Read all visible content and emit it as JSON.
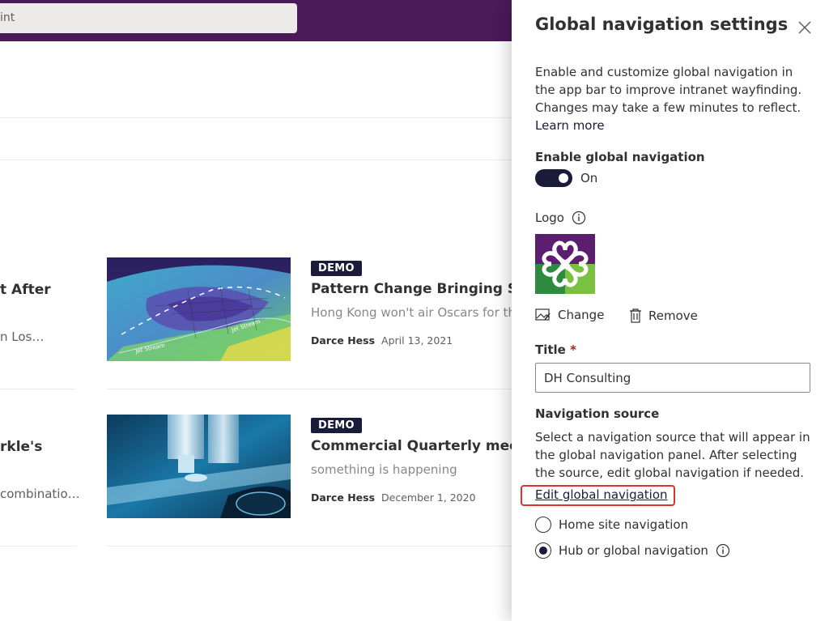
{
  "search": {
    "value": "int"
  },
  "news": [
    {
      "left_title": "t After",
      "left_desc": "n Los…",
      "badge": "DEMO",
      "title": "Pattern Change Bringing Show",
      "description": "Hong Kong won't air Oscars for the",
      "author": "Darce Hess",
      "date": "April 13, 2021",
      "thumb_labels": [
        "Jet Stream",
        "Jet Stream"
      ]
    },
    {
      "left_title": "rkle's",
      "left_desc": "combinatio…",
      "badge": "DEMO",
      "title": "Commercial Quarterly meetin",
      "description": "something is happening",
      "author": "Darce Hess",
      "date": "December 1, 2020"
    }
  ],
  "panel": {
    "title": "Global navigation settings",
    "description": "Enable and customize global navigation in the app bar to improve intranet wayfinding. Changes may take a few minutes to reflect.",
    "learn_more": "Learn more",
    "enable_label": "Enable global navigation",
    "toggle_state": "On",
    "logo_label": "Logo",
    "change_label": "Change",
    "remove_label": "Remove",
    "title_label": "Title",
    "title_required": "*",
    "title_value": "DH Consulting",
    "nav_source_label": "Navigation source",
    "nav_source_desc": "Select a navigation source that will appear in the global navigation panel. After selecting the source, edit global navigation if needed.",
    "edit_link": "Edit global navigation",
    "options": [
      {
        "label": "Home site navigation",
        "checked": false
      },
      {
        "label": "Hub or global navigation",
        "checked": true
      }
    ]
  },
  "colors": {
    "suite_bar": "#4b1a59",
    "accent": "#1b1b3a",
    "highlight": "#e03030"
  },
  "icons": [
    "close-icon",
    "info-icon",
    "change-image-icon",
    "trash-icon"
  ]
}
